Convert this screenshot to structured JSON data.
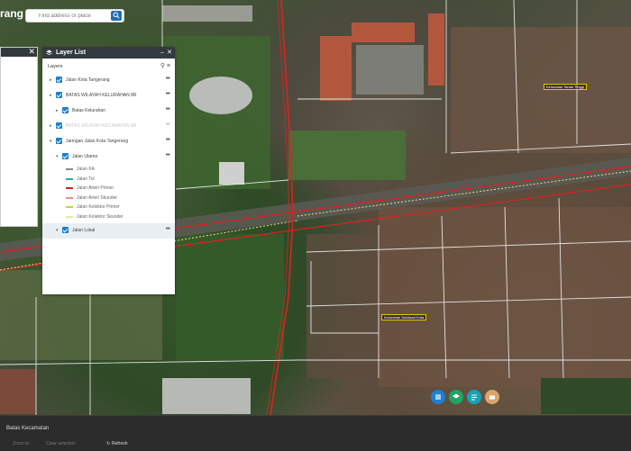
{
  "app": {
    "brand": "rang"
  },
  "search": {
    "placeholder": "Find address or place"
  },
  "layer_list": {
    "title": "Layer List",
    "subheader": "Layers",
    "layers": [
      {
        "label": "Jalan Kota Tangerang"
      },
      {
        "label": "BATAS WILAYAH KELURAHAN 8R"
      },
      {
        "label": "Batas Kelurahan"
      },
      {
        "label": "BATAS WILAYAH KECAMATAN 8R"
      },
      {
        "label": "Jaringan Jalan Kota Tangerang"
      },
      {
        "label": "Jalan Utama"
      },
      {
        "label": "Jalan Lokal"
      }
    ],
    "legend": [
      {
        "label": "Jalan KA",
        "color": "#8a8a8a"
      },
      {
        "label": "Jalan Tol",
        "color": "#37a0b8"
      },
      {
        "label": "Jalan Arteri Primer",
        "color": "#e02020"
      },
      {
        "label": "Jalan Arteri Skunder",
        "color": "#f28b8b"
      },
      {
        "label": "Jalan Kolektor Primer",
        "color": "#c8d63a"
      },
      {
        "label": "Jalan Kolektor Skunder",
        "color": "#e8eb9a"
      }
    ]
  },
  "map_labels": {
    "label_1": "Kelurahan Tanah Tinggi",
    "label_2": "Kelurahan Sukasari Kota"
  },
  "bottom_panel": {
    "title": "Batas Kecamatan",
    "actions": {
      "zoom_to": "Zoom to",
      "clear_selection": "Clear selection",
      "refresh": "Refresh"
    }
  },
  "colors": {
    "accent": "#1c7fd0",
    "header": "#343b40",
    "road_red": "#e02020"
  },
  "icons": [
    "search-icon",
    "layers-icon",
    "filter-icon",
    "close-icon",
    "more-icon",
    "refresh-icon"
  ]
}
